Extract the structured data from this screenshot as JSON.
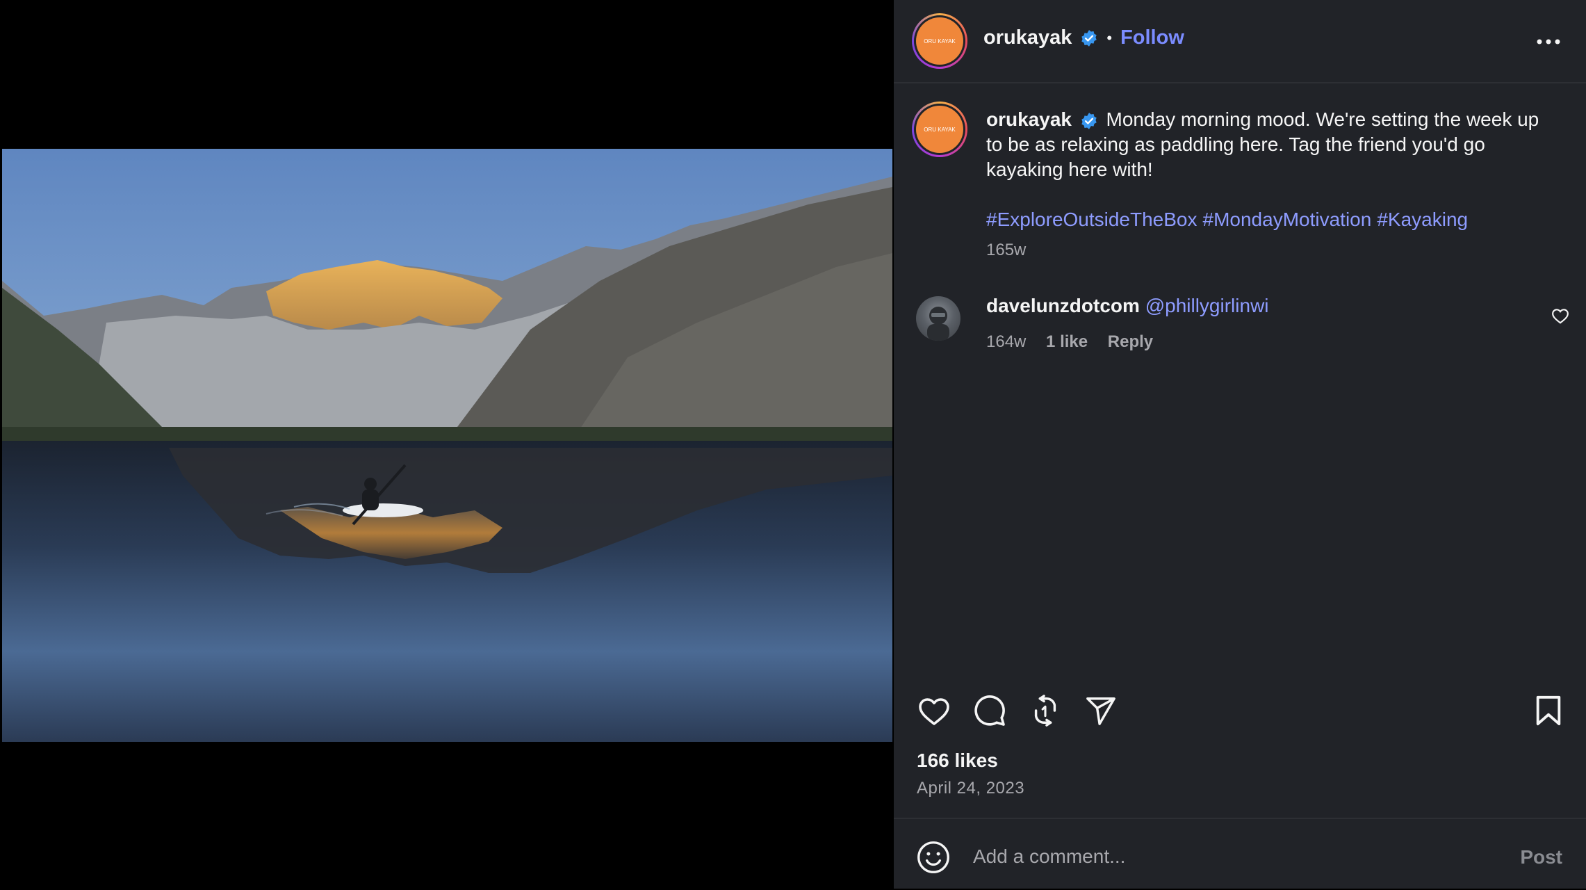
{
  "post": {
    "username": "orukayak",
    "follow_label": "Follow",
    "dot": "•",
    "avatar_text": "ORU KAYAK"
  },
  "caption": {
    "username": "orukayak",
    "text": "Monday morning mood. We're setting the week up to be as relaxing as paddling here. Tag the friend you'd go kayaking here with!",
    "hashtags": [
      "#ExploreOutsideTheBox",
      "#MondayMotivation",
      "#Kayaking"
    ],
    "time": "165w"
  },
  "comment": {
    "username": "davelunzdotcom",
    "mention": "@phillygirlinwi",
    "time": "164w",
    "likes": "1 like",
    "reply": "Reply"
  },
  "stats": {
    "likes": "166 likes",
    "date": "April 24, 2023"
  },
  "composer": {
    "placeholder": "Add a comment...",
    "post_label": "Post"
  },
  "colors": {
    "panel_bg": "#212328",
    "link": "#8e9cff",
    "verified": "#3897f0",
    "avatar_orange": "#f0873a"
  }
}
